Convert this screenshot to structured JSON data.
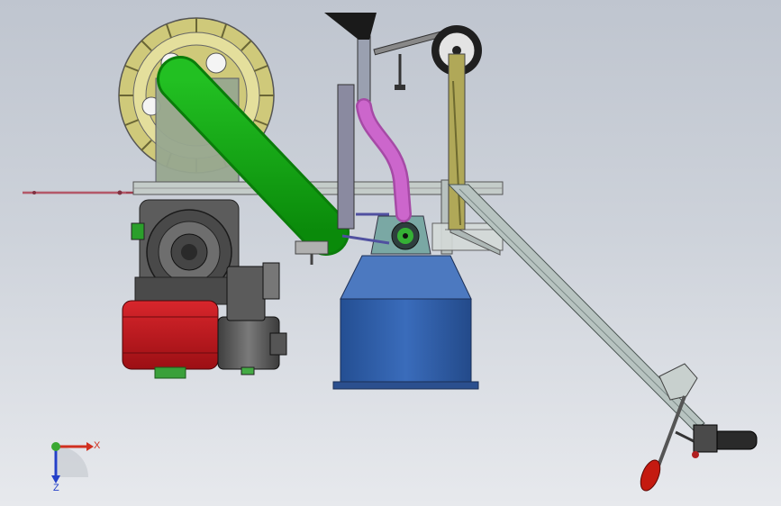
{
  "triad": {
    "x_label": "X",
    "z_label": "Z",
    "x_color": "#d03020",
    "y_color": "#3aa832",
    "z_color": "#2440c8"
  },
  "colors": {
    "hopper": "#2f5ea8",
    "fuel_tank": "#c4161c",
    "drive_belt": "#12a612",
    "flywheel": "#c8c26a",
    "feed_tube": "#c060c0",
    "frame": "#b8c2c0",
    "engine": "#5e5e5e",
    "handle_grip": "#c41a10"
  }
}
